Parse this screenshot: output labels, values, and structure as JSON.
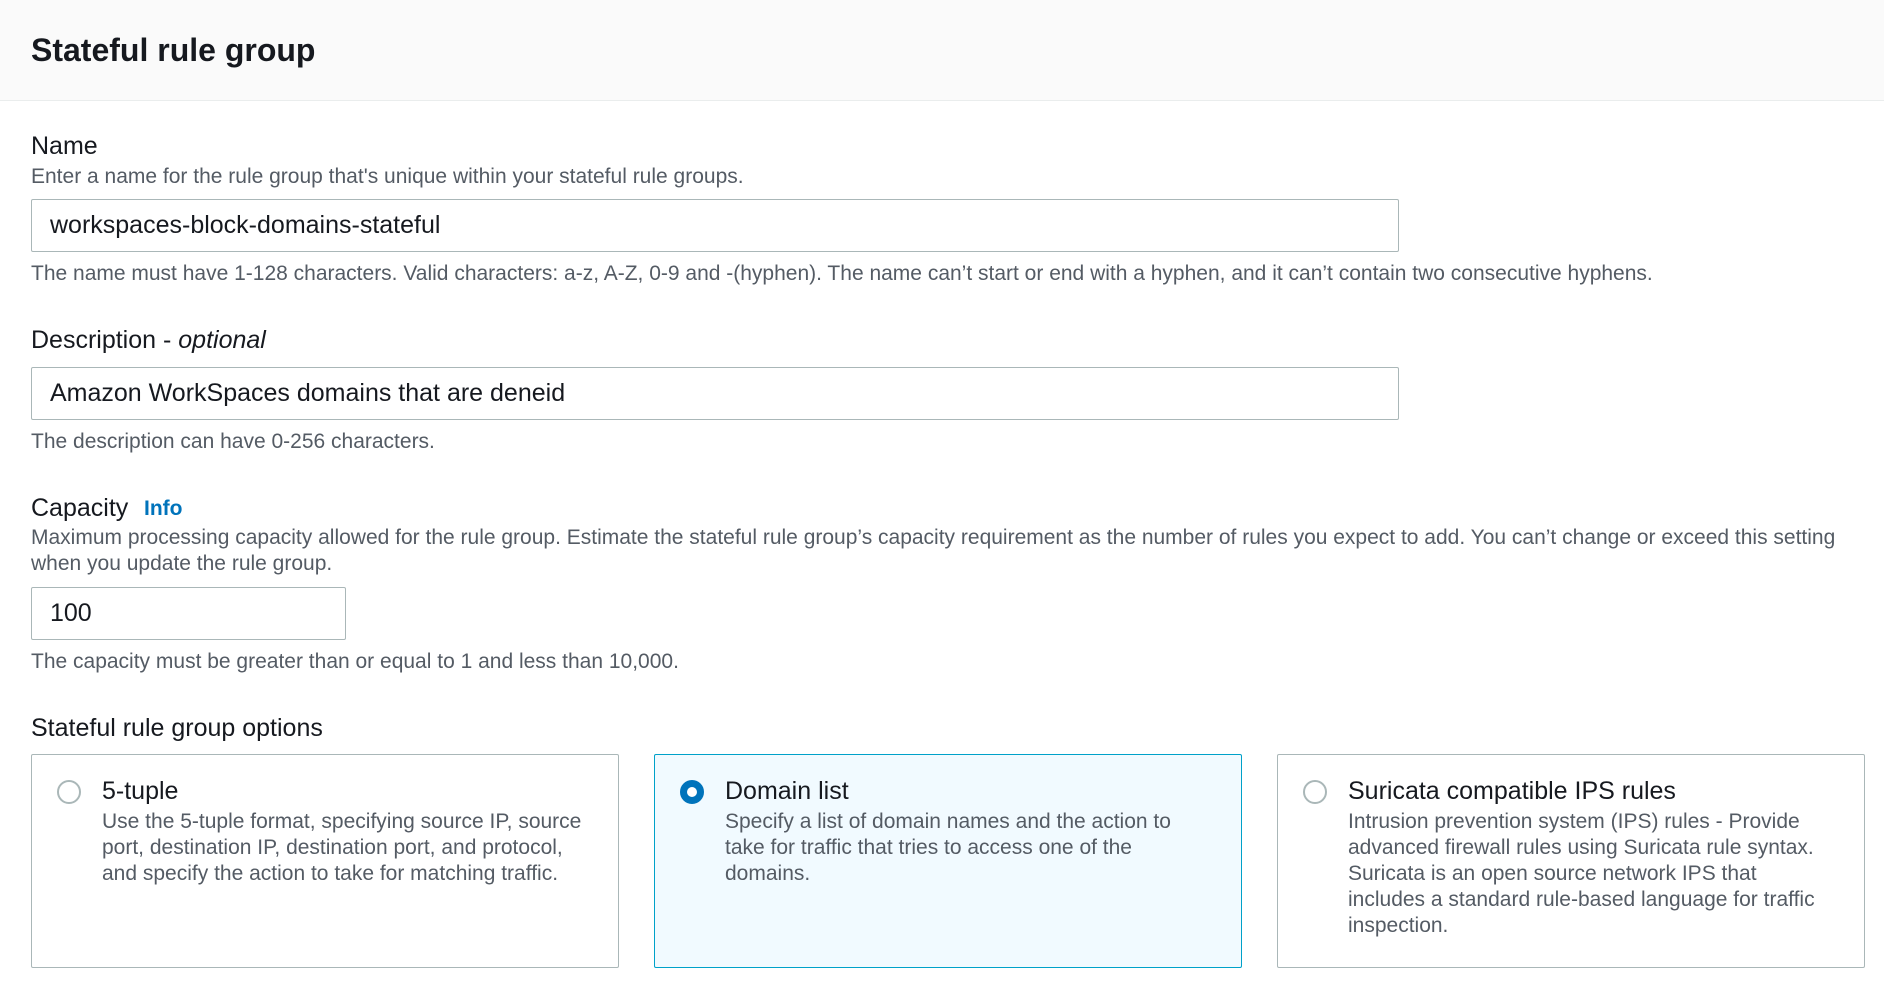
{
  "header": {
    "title": "Stateful rule group"
  },
  "name_field": {
    "label": "Name",
    "description": "Enter a name for the rule group that's unique within your stateful rule groups.",
    "value": "workspaces-block-domains-stateful",
    "constraint": "The name must have 1-128 characters. Valid characters: a-z, A-Z, 0-9 and -(hyphen). The name can’t start or end with a hyphen, and it can’t contain two consecutive hyphens."
  },
  "description_field": {
    "label": "Description - ",
    "label_optional": "optional",
    "value": "Amazon WorkSpaces domains that are deneid",
    "constraint": "The description can have 0-256 characters."
  },
  "capacity_field": {
    "label": "Capacity",
    "info_link": "Info",
    "description": "Maximum processing capacity allowed for the rule group. Estimate the stateful rule group’s capacity requirement as the number of rules you expect to add. You can’t change or exceed this setting when you update the rule group.",
    "value": "100",
    "constraint": "The capacity must be greater than or equal to 1 and less than 10,000."
  },
  "options": {
    "label": "Stateful rule group options",
    "tiles": [
      {
        "title": "5-tuple",
        "description": "Use the 5-tuple format, specifying source IP, source port, destination IP, destination port, and protocol, and specify the action to take for matching traffic.",
        "selected": false
      },
      {
        "title": "Domain list",
        "description": "Specify a list of domain names and the action to take for traffic that tries to access one of the domains.",
        "selected": true
      },
      {
        "title": "Suricata compatible IPS rules",
        "description": "Intrusion prevention system (IPS) rules - Provide advanced firewall rules using Suricata rule syntax. Suricata is an open source network IPS that includes a standard rule-based language for traffic inspection.",
        "selected": false
      }
    ]
  },
  "colors": {
    "accent": "#0073bb",
    "selected_border": "#00a1c9",
    "selected_background": "#f1faff",
    "text_primary": "#16191f",
    "text_secondary": "#545b64"
  }
}
